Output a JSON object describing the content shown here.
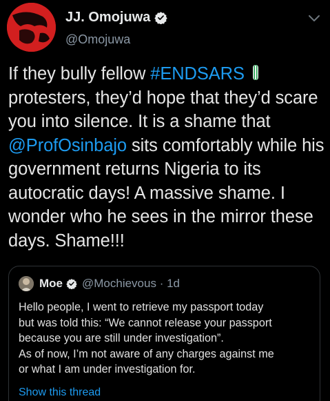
{
  "tweet": {
    "display_name": "JJ. Omojuwa",
    "handle": "@Omojuwa",
    "text_parts": {
      "p1": "If they bully fellow ",
      "hashtag": "#ENDSARS",
      "p2": " protesters, they’d hope that they’d scare you into silence. It is a shame that ",
      "mention": "@ProfOsinbajo",
      "p3": " sits comfortably while his government returns Nigeria to its autocratic days! A massive shame. I wonder who he sees in the mirror these days. Shame!!!"
    }
  },
  "quote": {
    "display_name": "Moe",
    "handle_time": "@Mochievous · 1d",
    "lines": [
      "Hello people, I went to retrieve my passport today",
      "but was told this: “We cannot release your passport",
      "because you are still under investigation”.",
      "As of now, I’m not aware of any charges against me",
      "or what I am under investigation for."
    ],
    "show_thread": "Show this thread"
  },
  "colors": {
    "background": "#000000",
    "link": "#1d9bf0",
    "secondary_text": "#8b98a5",
    "avatar_red": "#d21f1f"
  },
  "icons": {
    "verified": "verified-badge-icon",
    "caret": "chevron-down-icon",
    "emoji": "nigeria-flag-emoji-icon"
  }
}
